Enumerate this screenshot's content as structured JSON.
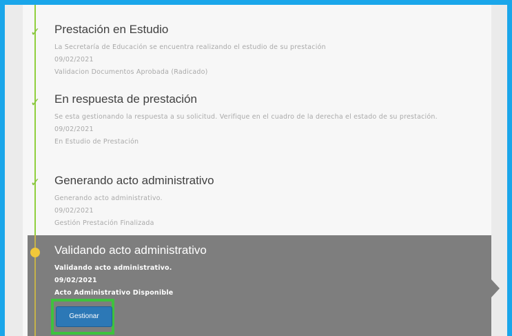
{
  "steps": [
    {
      "title": "Prestación en Estudio",
      "description": "La Secretaría de Educación se encuentra realizando el estudio de su prestación",
      "date": "09/02/2021",
      "status": "Validacion Documentos Aprobada (Radicado)"
    },
    {
      "title": "En respuesta de prestación",
      "description": "Se esta gestionando la respuesta a su solicitud. Verifique en el cuadro de la derecha el estado de su prestación.",
      "date": "09/02/2021",
      "status": "En Estudio de Prestación"
    },
    {
      "title": "Generando acto administrativo",
      "description": "Generando acto administrativo.",
      "date": "09/02/2021",
      "status": "Gestión Prestación Finalizada"
    },
    {
      "title": "Validando acto administrativo",
      "description": "Validando acto administrativo.",
      "date": "09/02/2021",
      "status": "Acto Administrativo Disponible",
      "button_label": "Gestionar"
    }
  ],
  "icons": {
    "completed": "checkmark-icon",
    "active": "circle-dot-icon"
  },
  "colors": {
    "frame_border": "#1aa6ea",
    "check": "#86c23d",
    "active_dot": "#f2c83a",
    "active_background": "#7e7e7e",
    "button": "#2c78b6",
    "highlight": "#3ec23e"
  }
}
